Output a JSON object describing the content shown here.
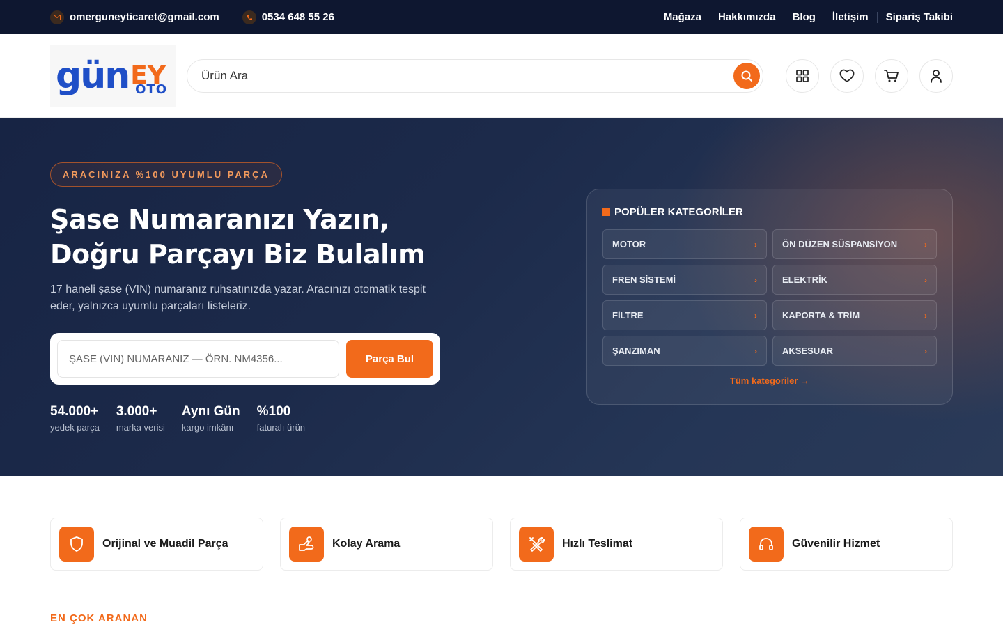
{
  "topbar": {
    "email": "omerguneyticaret@gmail.com",
    "phone": "0534 648 55 26",
    "nav": [
      "Mağaza",
      "Hakkımızda",
      "Blog",
      "İletişim",
      "Sipariş Takibi"
    ]
  },
  "header": {
    "logo": {
      "main": "gün",
      "accent": "EY",
      "sub": "OTO"
    },
    "search_placeholder": "Ürün Ara",
    "icons": [
      "grid-icon",
      "heart-icon",
      "cart-icon",
      "user-icon"
    ]
  },
  "hero": {
    "badge": "ARACINIZA %100 UYUMLU PARÇA",
    "title_line1": "Şase Numaranızı Yazın,",
    "title_line2": "Doğru Parçayı Biz Bulalım",
    "description": "17 haneli şase (VIN) numaranız ruhsatınızda yazar. Aracınızı otomatik tespit eder, yalnızca uyumlu parçaları listeleriz.",
    "vin_placeholder": "ŞASE (VIN) NUMARANIZ — ÖRN. NM4356...",
    "vin_button": "Parça Bul",
    "stats": [
      {
        "value": "54.000+",
        "label": "yedek parça"
      },
      {
        "value": "3.000+",
        "label": "marka verisi"
      },
      {
        "value": "Aynı Gün",
        "label": "kargo imkânı"
      },
      {
        "value": "%100",
        "label": "faturalı ürün"
      }
    ]
  },
  "categories": {
    "title": "POPÜLER KATEGORİLER",
    "items": [
      "MOTOR",
      "ÖN DÜZEN SÜSPANSİYON",
      "FREN SİSTEMİ",
      "ELEKTRİK",
      "FİLTRE",
      "KAPORTA & TRİM",
      "ŞANZIMAN",
      "AKSESUAR"
    ],
    "all_link": "Tüm kategoriler →"
  },
  "features": [
    {
      "label": "Orijinal ve Muadil Parça",
      "icon": "shield-icon"
    },
    {
      "label": "Kolay Arama",
      "icon": "hand-search-icon"
    },
    {
      "label": "Hızlı Teslimat",
      "icon": "tools-icon"
    },
    {
      "label": "Güvenilir Hizmet",
      "icon": "headset-icon"
    }
  ],
  "section": {
    "label": "EN ÇOK ARANAN"
  },
  "colors": {
    "accent": "#f26a1b",
    "brand_blue": "#1f4fc7",
    "topbar": "#0e1730"
  }
}
